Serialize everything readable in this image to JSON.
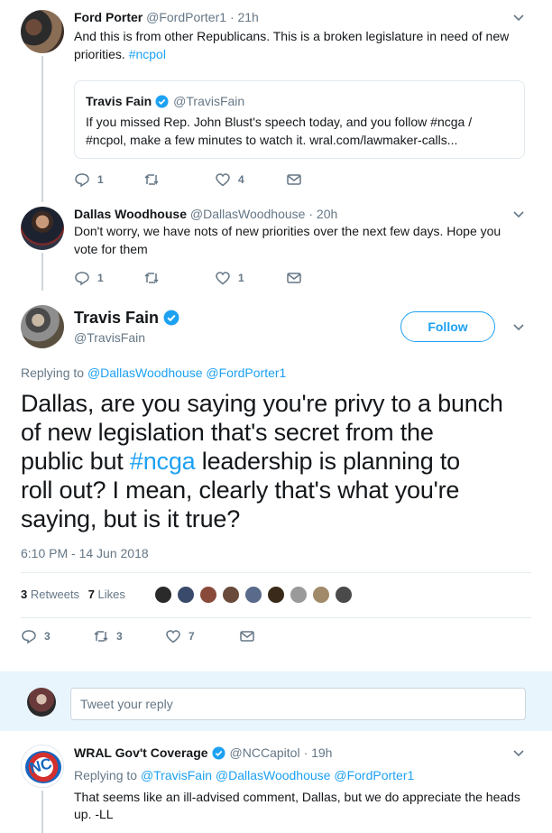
{
  "tweet1": {
    "name": "Ford Porter",
    "handle": "@FordPorter1",
    "time": "· 21h",
    "text_line1": "And this is from other Republicans. This is a broken legislature in need of new",
    "text_line2_plain": "priorities. ",
    "text_line2_link": "#ncpol",
    "quote": {
      "name": "Travis Fain",
      "handle": "@TravisFain",
      "line1": "If you missed Rep. John Blust's speech today, and you follow #ncga /",
      "line2": "#ncpol, make a few minutes to watch it. wral.com/lawmaker-calls..."
    },
    "replies": "1",
    "retweets": "",
    "likes": "4"
  },
  "tweet2": {
    "name": "Dallas Woodhouse",
    "handle": "@DallasWoodhouse",
    "time": "· 20h",
    "text_line1": "Don't worry, we have nots of new priorities over the next few days. Hope you",
    "text_line2": "vote for them",
    "replies": "1",
    "retweets": "",
    "likes": "1"
  },
  "main": {
    "name": "Travis Fain",
    "handle": "@TravisFain",
    "follow_label": "Follow",
    "replying_prefix": "Replying to ",
    "replying_to_1": "@DallasWoodhouse",
    "replying_to_2": "@FordPorter1",
    "text_line1": "Dallas, are you saying you're privy to a bunch",
    "text_line2": "of new legislation that's secret from the",
    "text_line3_a": "public but ",
    "text_line3_link": "#ncga",
    "text_line3_b": " leadership is planning to",
    "text_line4": "roll out? I mean, clearly that's what you're",
    "text_line5": "saying, but is it true?",
    "timestamp": "6:10 PM - 14 Jun 2018",
    "retweets_count": "3",
    "retweets_label": "Retweets",
    "likes_count": "7",
    "likes_label": "Likes",
    "replies": "3",
    "retweets": "3",
    "likes": "7"
  },
  "reply_box": {
    "placeholder": "Tweet your reply"
  },
  "tweet3": {
    "name": "WRAL Gov't Coverage",
    "handle": "@NCCapitol",
    "time": "· 19h",
    "replying_prefix": "Replying to ",
    "replying_to_1": "@TravisFain",
    "replying_to_2": "@DallasWoodhouse",
    "replying_to_3": "@FordPorter1",
    "text_line1": "That seems like an ill-advised comment, Dallas, but we do appreciate the heads",
    "text_line2": "up. -LL",
    "avatar_text": "NC"
  },
  "colors": {
    "accent": "#1da1f2",
    "muted": "#657786",
    "border": "#e1e8ed"
  }
}
